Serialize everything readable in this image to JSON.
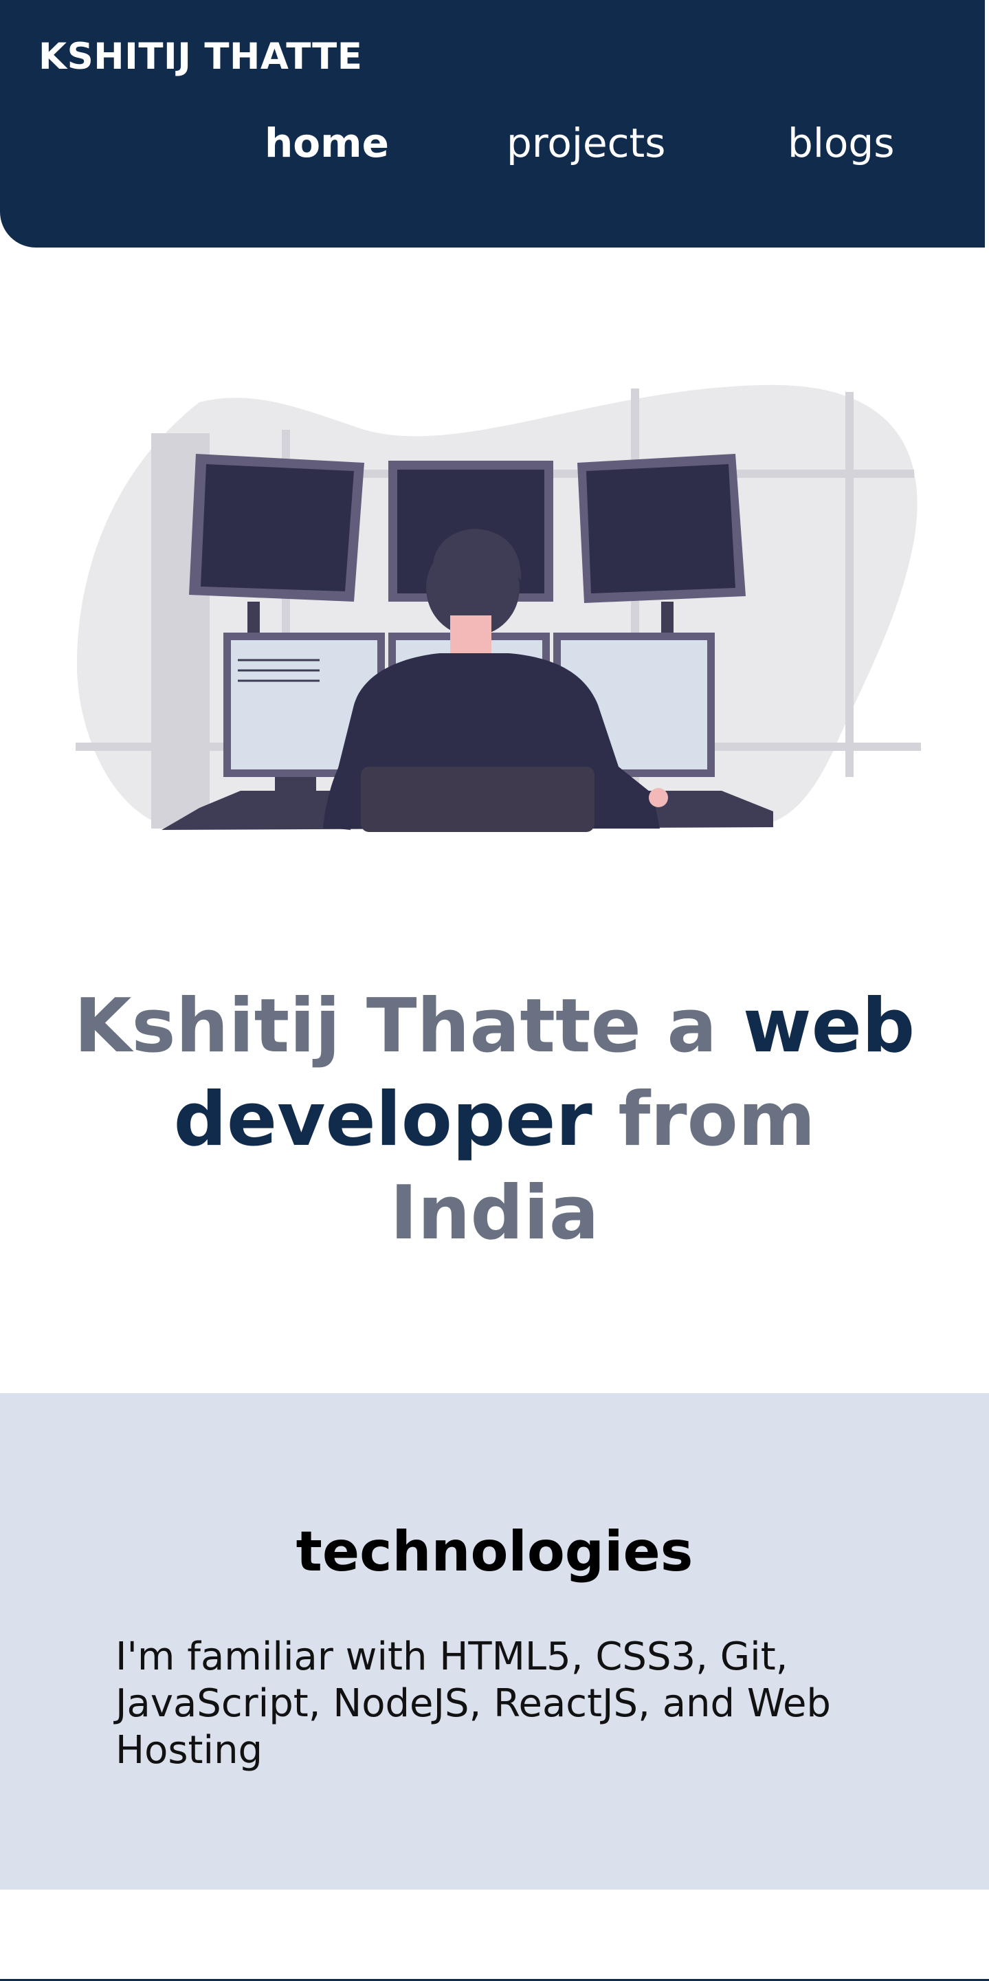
{
  "header": {
    "brand": "KSHITIJ THATTE",
    "nav": {
      "home": "home",
      "projects": "projects",
      "blogs": "blogs"
    }
  },
  "hero": {
    "illustration_icon": "developer-at-monitors-illustration",
    "headline": {
      "part1": "Kshitij Thatte a ",
      "accent": "web developer",
      "part2": " from India"
    }
  },
  "technologies": {
    "title": "technologies",
    "text": "I'm familiar with HTML5, CSS3, Git, JavaScript, NodeJS, ReactJS, and Web Hosting"
  },
  "colors": {
    "navy": "#112b4c",
    "gray_text": "#6a7182",
    "tech_bg": "#dbe0ed"
  }
}
